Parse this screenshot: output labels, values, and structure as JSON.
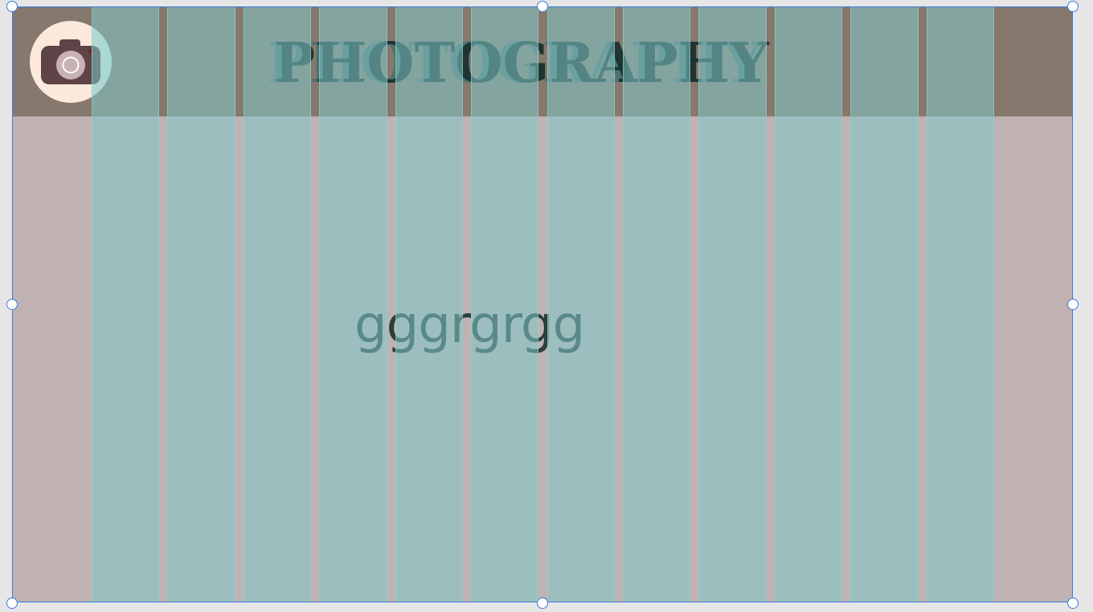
{
  "canvas": {
    "title": "PHOTOGRAPHY",
    "body_text": "gggrgrgg",
    "logo_icon": "camera-icon",
    "colors": {
      "workspace": "#e6e6e6",
      "page": "#c0b2b2",
      "header": "#87786d",
      "grid_overlay": "#80c8c8",
      "selection": "#3c7cdc",
      "logo_background": "#fbe9dc",
      "camera": "#5e4446"
    }
  },
  "layout_grid": {
    "visible": true,
    "column_count": 12
  },
  "selection": {
    "active": true
  }
}
